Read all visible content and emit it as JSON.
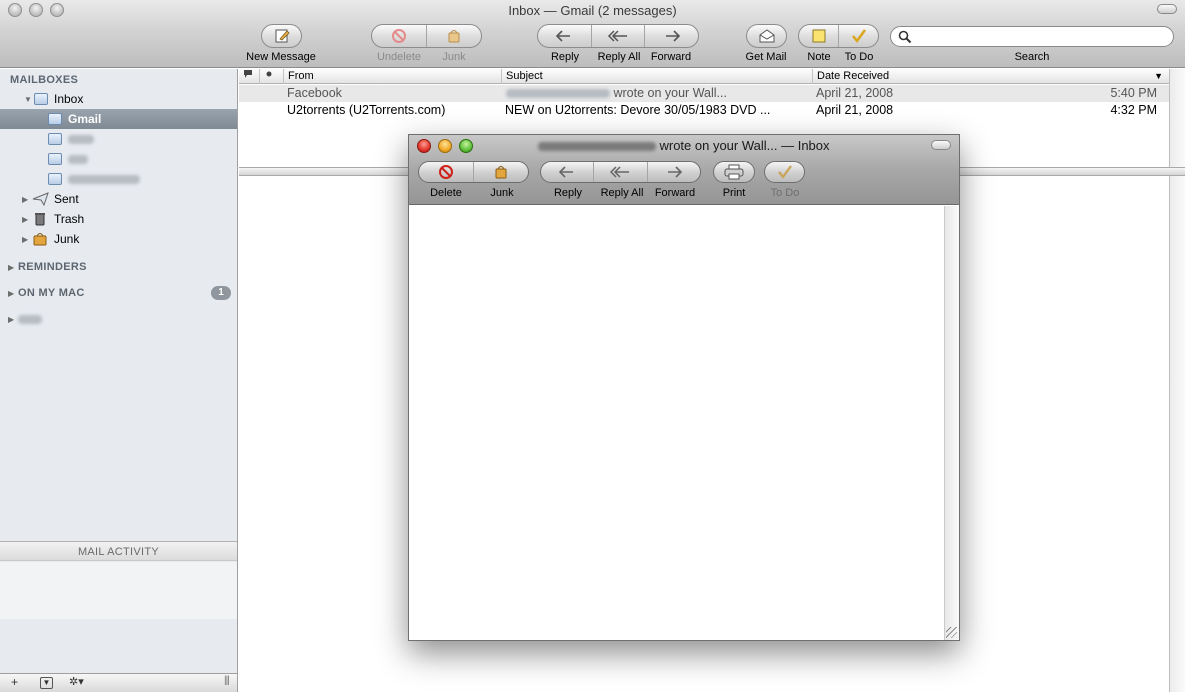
{
  "window": {
    "title": "Inbox — Gmail (2 messages)"
  },
  "toolbar": {
    "new_message": "New Message",
    "undelete": "Undelete",
    "junk": "Junk",
    "reply": "Reply",
    "reply_all": "Reply All",
    "forward": "Forward",
    "get_mail": "Get Mail",
    "note": "Note",
    "todo": "To Do",
    "search": "Search",
    "search_value": ""
  },
  "sidebar": {
    "mailboxes_header": "MAILBOXES",
    "inbox": "Inbox",
    "gmail": "Gmail",
    "sent": "Sent",
    "trash": "Trash",
    "junk": "Junk",
    "reminders": "REMINDERS",
    "on_my_mac": "ON MY MAC",
    "on_my_mac_count": "1",
    "mail_activity": "MAIL ACTIVITY",
    "add": "+",
    "gear": "✲▾",
    "resize": "|||"
  },
  "list": {
    "columns": {
      "from": "From",
      "subject": "Subject",
      "date": "Date Received"
    },
    "rows": [
      {
        "from": "Facebook",
        "subject": "wrote on your Wall...",
        "date": "April 21, 2008",
        "time": "5:40 PM"
      },
      {
        "from": "U2torrents (U2Torrents.com)",
        "subject": "NEW on U2torrents: Devore  30/05/1983  DVD ...",
        "date": "April 21, 2008",
        "time": "4:32 PM"
      }
    ]
  },
  "message_window": {
    "title": "wrote on your Wall... — Inbox",
    "delete": "Delete",
    "junk": "Junk",
    "reply": "Reply",
    "reply_all": "Reply All",
    "forward": "Forward",
    "print": "Print",
    "todo": "To Do"
  }
}
